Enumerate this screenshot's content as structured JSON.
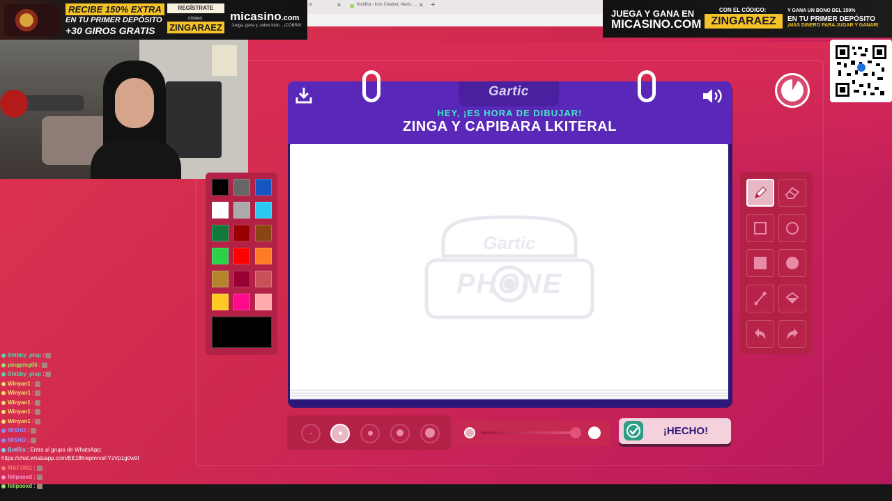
{
  "browser": {
    "tabs": [
      {
        "label": "m"
      },
      {
        "label": "KickBot - Kick Chatbot, Alerts, ..."
      }
    ],
    "new_tab": "+"
  },
  "ads": {
    "left": {
      "headline": "RECIBE 150% EXTRA",
      "line2": "EN TU PRIMER DEPÓSITO",
      "line3": "+30 GIROS GRATIS",
      "register": "REGÍSTRATE",
      "code_label": "CÓDIGO",
      "code": "ZINGARAEZ",
      "brand": "micasino",
      "brand_suffix": ".com",
      "tagline": "Juega, gana y, sobre todo... ¡COBRA!"
    },
    "right": {
      "line1": "JUEGA Y GANA EN",
      "line2": "MICASINO.COM",
      "code_label": "CON EL CÓDIGO:",
      "code": "ZINGARAEZ",
      "bonus1": "Y GANA UN BONO DEL 150%",
      "bonus2": "EN TU PRIMER DEPÓSITO",
      "bonus3": "¡MÁS DINERO PARA JUGAR Y GANAR!"
    }
  },
  "game": {
    "logo": "Gartic",
    "hey": "HEY, ¡ES HORA DE DIBUJAR!",
    "prompt": "ZINGA Y CAPIBARA LKITERAL",
    "watermark_top": "Gartic",
    "watermark_bottom": "PHONE",
    "done_label": "¡HECHO!",
    "colors": [
      "#000000",
      "#666666",
      "#1556c0",
      "#ffffff",
      "#aaaaaa",
      "#2ac8f2",
      "#117a3a",
      "#990000",
      "#8b4513",
      "#2ad149",
      "#ff0000",
      "#ff7b23",
      "#b5852b",
      "#990033",
      "#c8515a",
      "#ffc924",
      "#ff0a8c",
      "#ffaaab"
    ],
    "selected_color": "#000000",
    "tools": [
      "pencil",
      "eraser",
      "rectangle-outline",
      "ellipse-outline",
      "rectangle-filled",
      "ellipse-filled",
      "line",
      "fill-bucket",
      "undo",
      "redo"
    ],
    "active_tool": "pencil",
    "brush_sizes": 5,
    "active_brush_size": 2,
    "opacity": 1
  },
  "chat": [
    {
      "user": "Shibby_plup",
      "text": " :",
      "color": "#57d6b0"
    },
    {
      "user": "pingping06",
      "text": " :",
      "color": "#9be66a"
    },
    {
      "user": "Shibby_plup",
      "text": " :",
      "color": "#57d6b0"
    },
    {
      "user": "Winyan1",
      "text": " :",
      "color": "#f3e36a"
    },
    {
      "user": "Winyan1",
      "text": " :",
      "color": "#f3e36a"
    },
    {
      "user": "Winyan1",
      "text": " :",
      "color": "#f3e36a"
    },
    {
      "user": "Winyan1",
      "text": " :",
      "color": "#f3e36a"
    },
    {
      "user": "Winyan1",
      "text": " :",
      "color": "#f3e36a"
    },
    {
      "user": "MISHO",
      "text": " :",
      "color": "#8e8bff"
    },
    {
      "user": "MISHO",
      "text": " :",
      "color": "#8e8bff"
    },
    {
      "user": "BotRix",
      "text": " : Entra al grupo de WhatsApp:",
      "color": "#7dd8ff"
    },
    {
      "user": "",
      "text": "https://chat.whatsapp.com/EE18KwpmrvsFYzVp1g0w9I",
      "color": "#ffffff"
    },
    {
      "user": "MAF1001",
      "text": " :",
      "color": "#ff7a7a"
    },
    {
      "user": "felipaoxd",
      "text": " :",
      "color": "#ff9ad6"
    },
    {
      "user": "felipaoxd",
      "text": " :",
      "color": "#9be66a"
    }
  ]
}
